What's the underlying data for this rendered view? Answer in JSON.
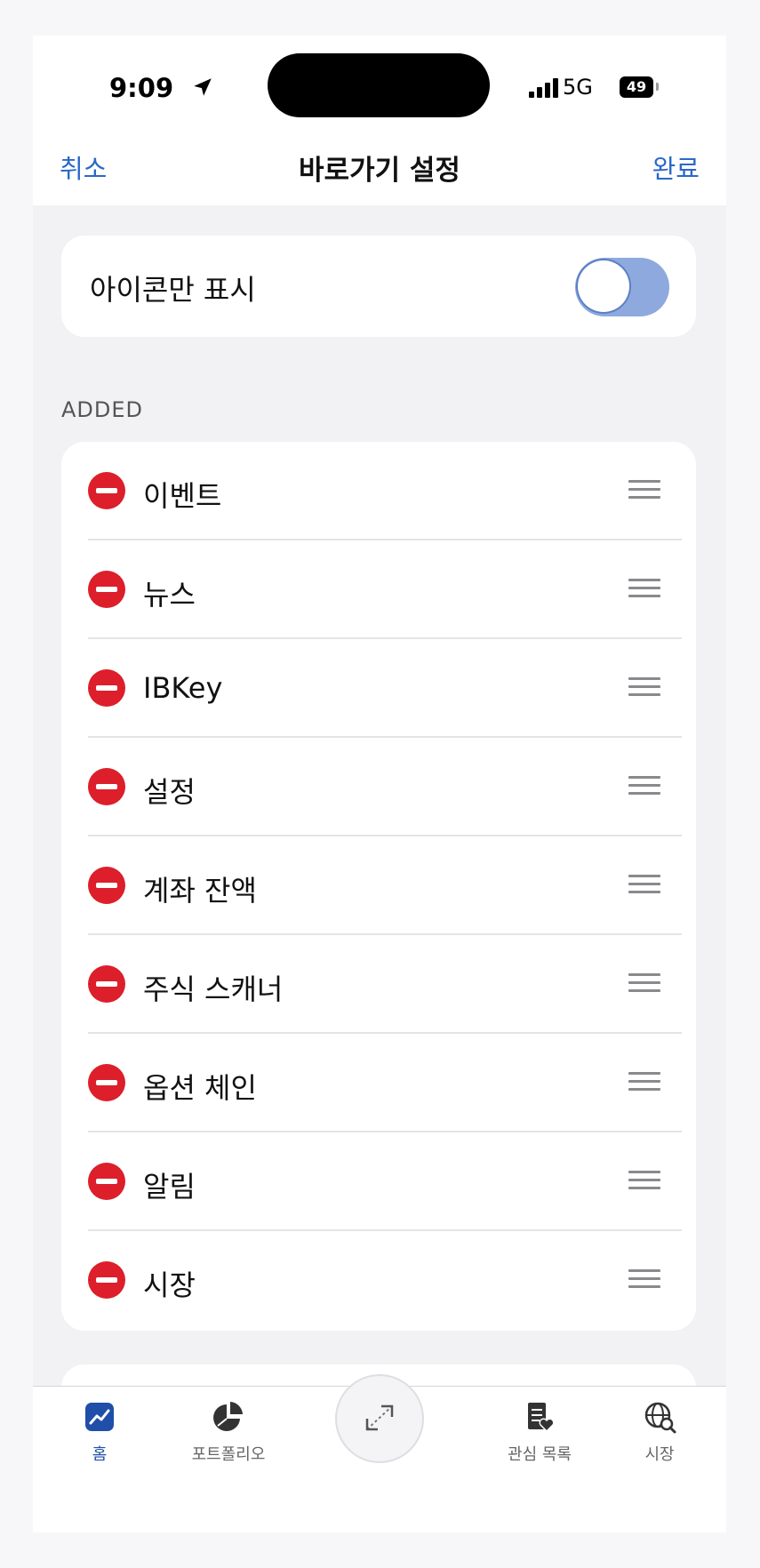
{
  "status_bar": {
    "time": "9:09",
    "network": "5G",
    "battery": "49"
  },
  "nav": {
    "cancel": "취소",
    "title": "바로가기 설정",
    "done": "완료"
  },
  "settings": {
    "icons_only_label": "아이콘만 표시",
    "icons_only_on": false
  },
  "section": {
    "added_header": "ADDED"
  },
  "added_items": [
    "이벤트",
    "뉴스",
    "IBKey",
    "설정",
    "계좌 잔액",
    "주식 스캐너",
    "옵션 체인",
    "알림",
    "시장"
  ],
  "tabbar": {
    "home": "홈",
    "portfolio": "포트폴리오",
    "watchlist": "관심 목록",
    "market": "시장"
  },
  "colors": {
    "accent": "#2a68c9",
    "delete": "#dc1f2a",
    "toggle_track": "#8ea9de"
  }
}
